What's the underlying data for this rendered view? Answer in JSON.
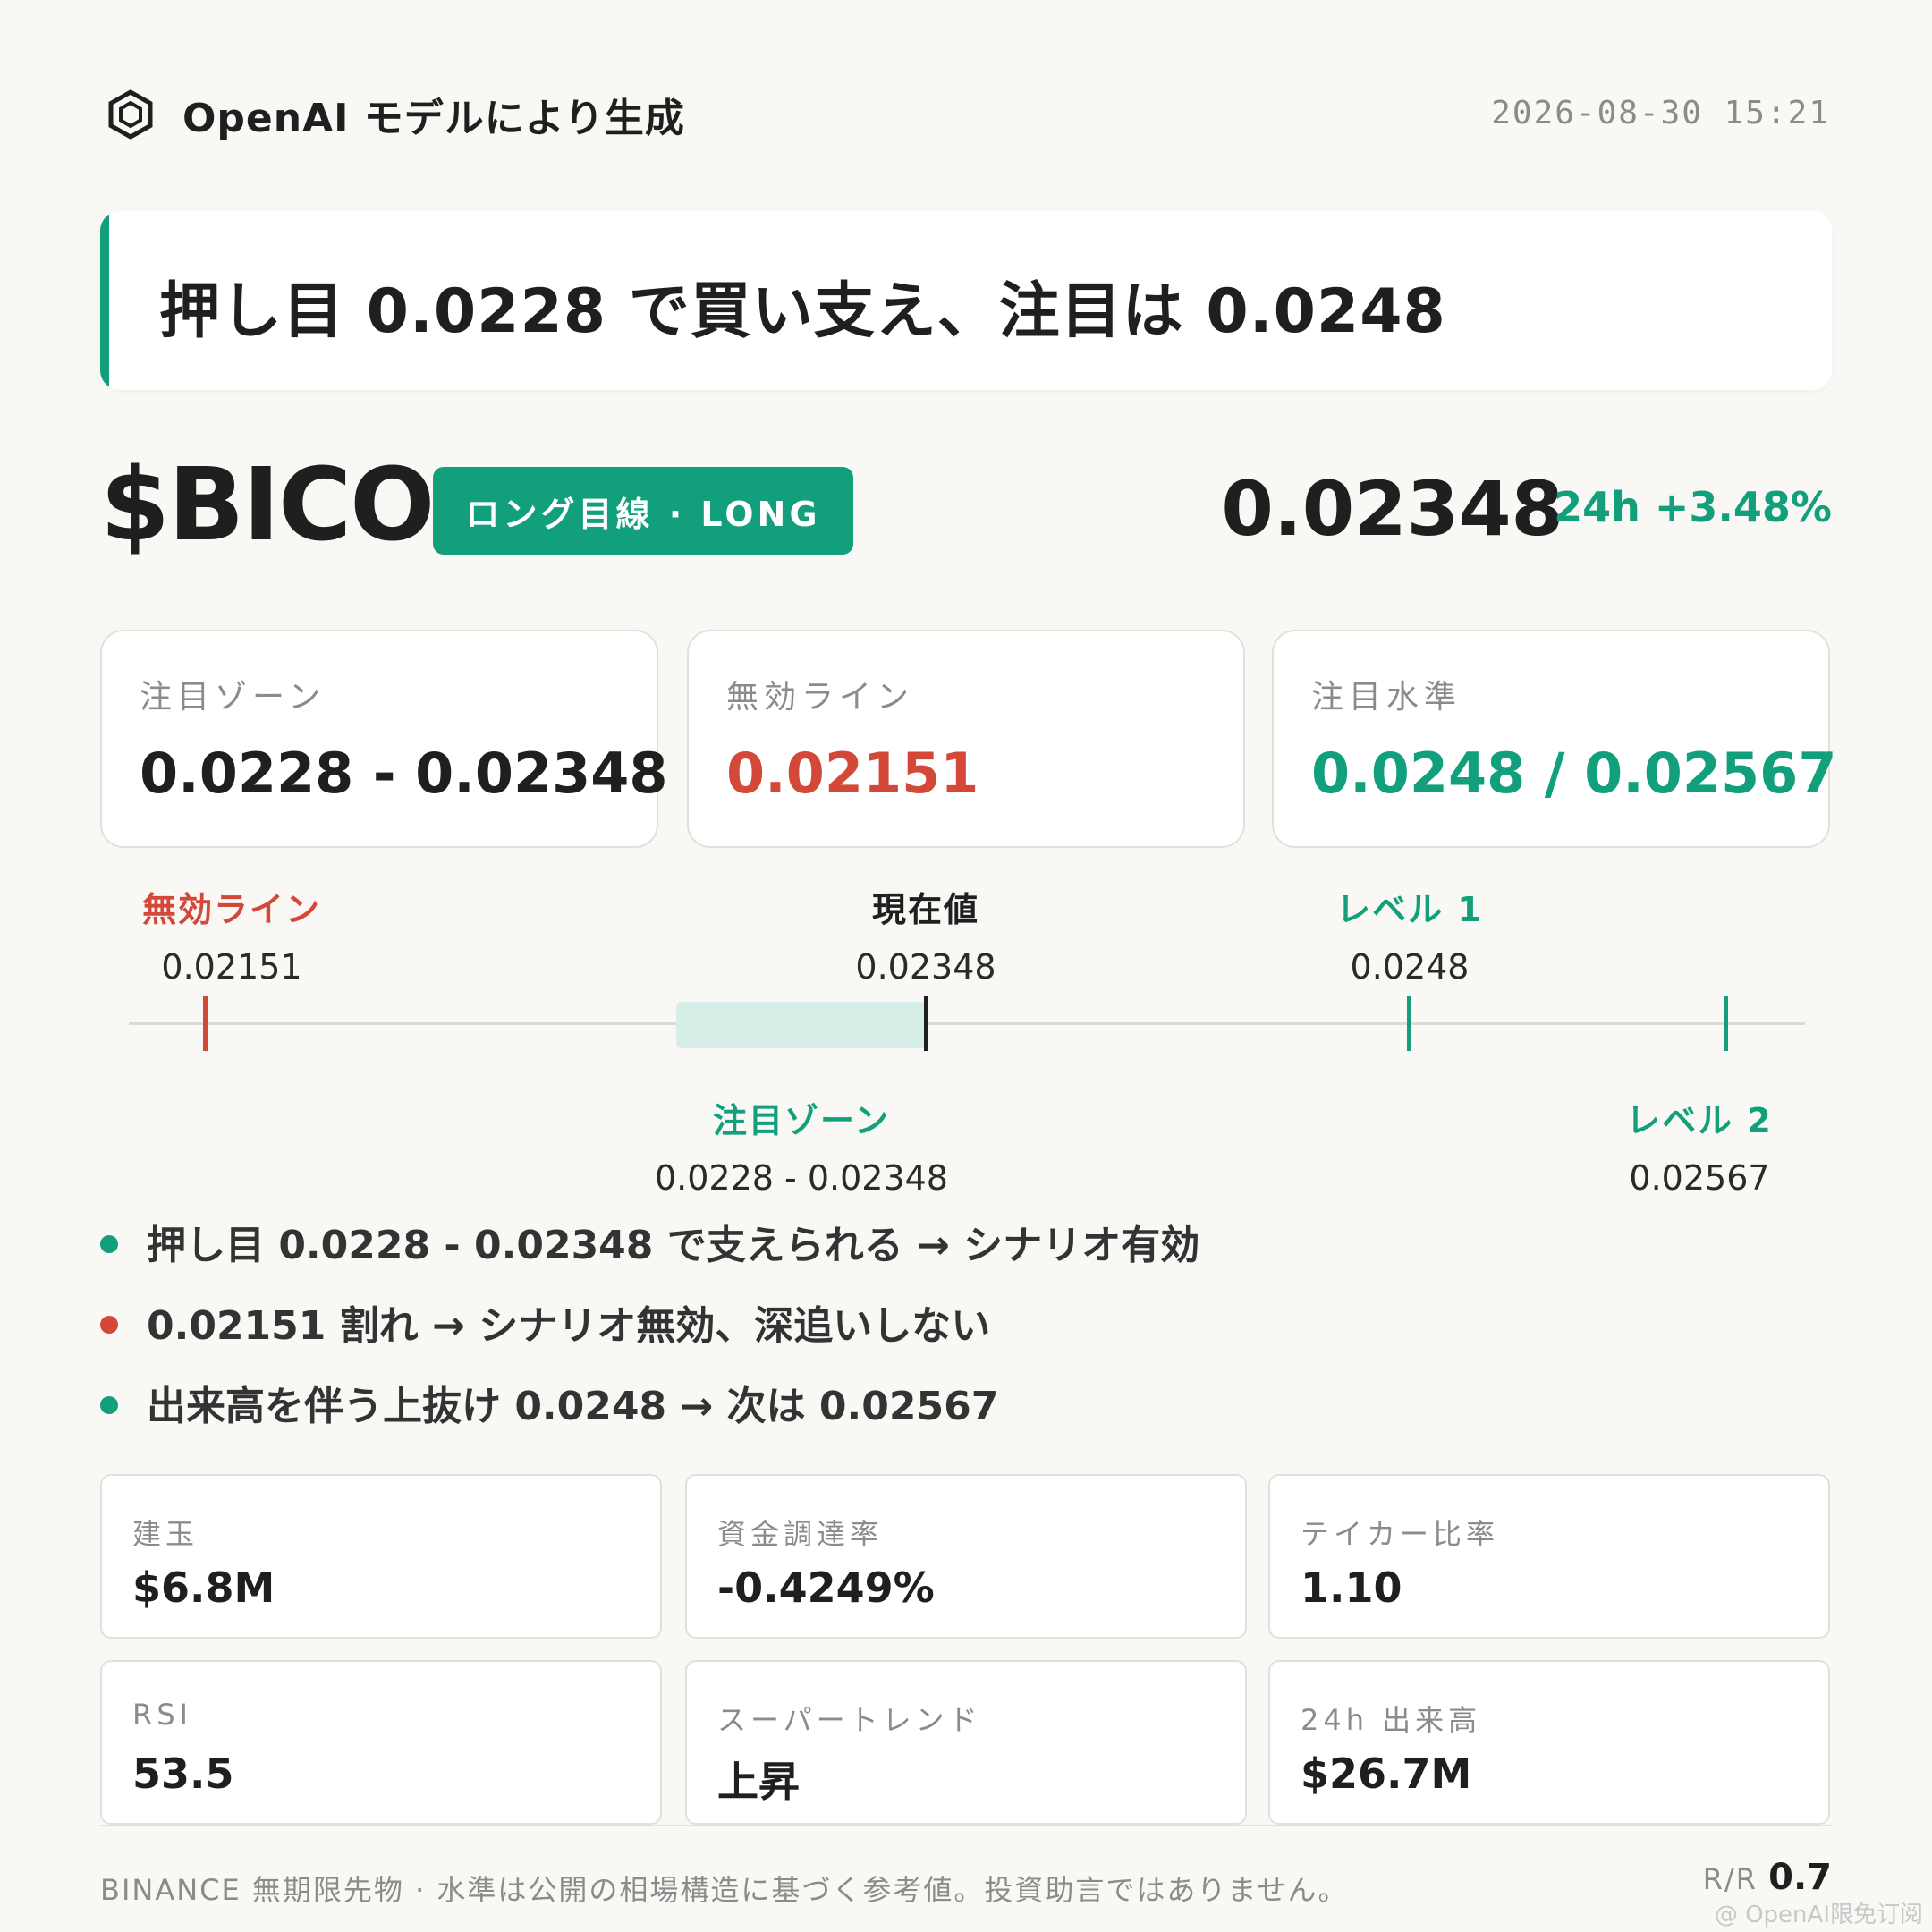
{
  "header": {
    "brand": "OpenAI モデルにより生成",
    "timestamp": "2026-08-30 15:21"
  },
  "headline": "押し目 0.0228 で買い支え、注目は 0.0248",
  "symbol": "$BICO",
  "direction_badge": "ロング目線 · LONG",
  "price": "0.02348",
  "change_24h": "24h +3.48%",
  "level_cards": {
    "zone": {
      "label": "注目ゾーン",
      "value": "0.0228 - 0.02348"
    },
    "invalidation": {
      "label": "無効ライン",
      "value": "0.02151"
    },
    "targets": {
      "label": "注目水準",
      "value": "0.0248 / 0.02567"
    }
  },
  "price_line": {
    "invalidation": {
      "title": "無効ライン",
      "value": "0.02151"
    },
    "current": {
      "title": "現在値",
      "value": "0.02348"
    },
    "level1": {
      "title": "レベル 1",
      "value": "0.0248"
    },
    "zone": {
      "title": "注目ゾーン",
      "value": "0.0228 - 0.02348"
    },
    "level2": {
      "title": "レベル 2",
      "value": "0.02567"
    }
  },
  "bullets": [
    {
      "text": "押し目 0.0228 - 0.02348 で支えられる → シナリオ有効",
      "color": "#12a07c"
    },
    {
      "text": "0.02151 割れ → シナリオ無効、深追いしない",
      "color": "#d4483a"
    },
    {
      "text": "出来高を伴う上抜け 0.0248 → 次は 0.02567",
      "color": "#12a07c"
    }
  ],
  "metrics": {
    "open_interest": {
      "label": "建玉",
      "value": "$6.8M"
    },
    "funding_rate": {
      "label": "資金調達率",
      "value": "-0.4249%"
    },
    "taker_ratio": {
      "label": "テイカー比率",
      "value": "1.10"
    },
    "rsi": {
      "label": "RSI",
      "value": "53.5"
    },
    "supertrend": {
      "label": "スーパートレンド",
      "value": "上昇"
    },
    "volume_24h": {
      "label": "24h 出来高",
      "value": "$26.7M"
    }
  },
  "footer": {
    "disclaimer": "BINANCE 無期限先物 · 水準は公開の相場構造に基づく参考値。投資助言ではありません。",
    "rr_label": "R/R ",
    "rr_value": "0.7"
  },
  "watermark": "@ OpenAI限免订阅",
  "colors": {
    "accent": "#12a07c",
    "danger": "#d4483a",
    "background": "#f9f8f5"
  },
  "icons": {
    "logo": "hexagon-logo-icon"
  }
}
